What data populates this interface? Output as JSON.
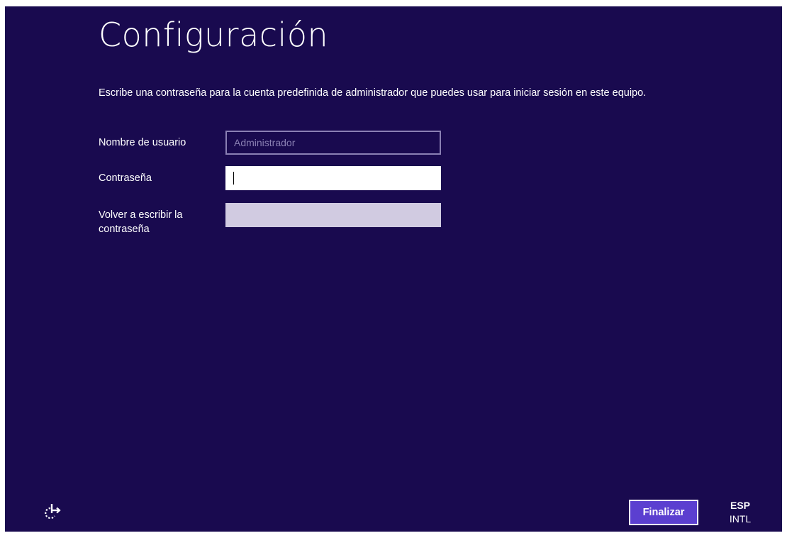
{
  "page": {
    "title": "Configuración",
    "instructions": "Escribe una contraseña para la cuenta predefinida de administrador que puedes usar para iniciar sesión en este equipo."
  },
  "form": {
    "username": {
      "label": "Nombre de usuario",
      "placeholder": "Administrador",
      "value": ""
    },
    "password": {
      "label": "Contraseña",
      "value": ""
    },
    "confirm_password": {
      "label": "Volver a escribir la contraseña",
      "value": ""
    }
  },
  "footer": {
    "accessibility_icon": "ease-of-access-icon",
    "finish_label": "Finalizar",
    "language_code": "ESP",
    "keyboard_layout": "INTL"
  },
  "colors": {
    "background": "#190a4f",
    "button": "#5b3fd0",
    "disabled_field_border": "#8a80b3",
    "confirm_field": "#d1cbe1"
  }
}
